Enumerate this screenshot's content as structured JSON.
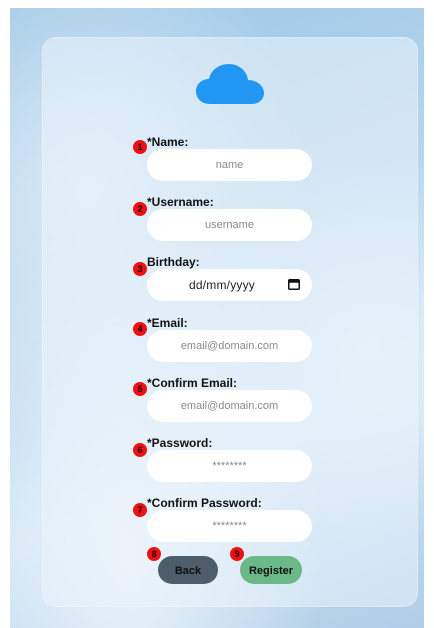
{
  "form": {
    "logo_icon": "cloud-icon",
    "fields": [
      {
        "badge": "1",
        "label": "*Name:",
        "placeholder": "name"
      },
      {
        "badge": "2",
        "label": "*Username:",
        "placeholder": "username"
      },
      {
        "badge": "3",
        "label": "Birthday:",
        "value": "dd/mm/yyyy",
        "icon": "calendar-icon"
      },
      {
        "badge": "4",
        "label": "*Email:",
        "placeholder": "email@domain.com"
      },
      {
        "badge": "5",
        "label": "*Confirm Email:",
        "placeholder": "email@domain.com"
      },
      {
        "badge": "6",
        "label": "*Password:",
        "placeholder": "********"
      },
      {
        "badge": "7",
        "label": "*Confirm Password:",
        "placeholder": "********"
      }
    ],
    "buttons": {
      "back": {
        "badge": "8",
        "label": "Back"
      },
      "register": {
        "badge": "9",
        "label": "Register"
      }
    }
  },
  "colors": {
    "accent_cloud": "#2196f3",
    "badge": "#ee1111",
    "back_button": "#4d5d6a",
    "register_button": "#6ab987"
  }
}
